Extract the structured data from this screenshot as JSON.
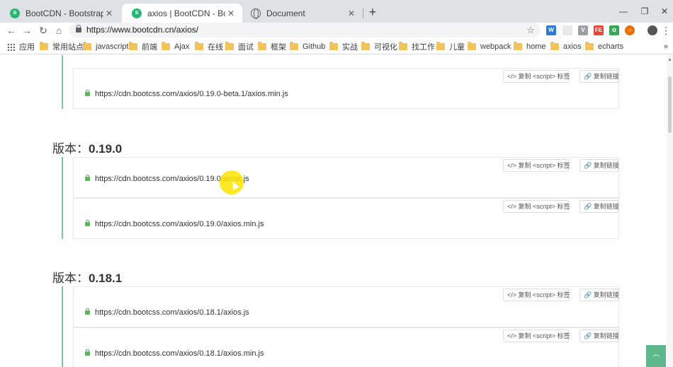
{
  "tabs": [
    {
      "title": "BootCDN - Bootstrap 中文网开",
      "icon": "bootcdn-icon"
    },
    {
      "title": "axios | BootCDN - Bootstrap 中",
      "icon": "bootcdn-icon"
    },
    {
      "title": "Document",
      "icon": "globe-icon"
    }
  ],
  "omnibox": {
    "url": "https://www.bootcdn.cn/axios/"
  },
  "bookmarks": {
    "apps": "应用",
    "items": [
      "常用站点",
      "javascript",
      "前端",
      "Ajax",
      "在线",
      "面试",
      "框架",
      "Github",
      "实战",
      "可视化",
      "找工作",
      "儿童",
      "webpack",
      "home",
      "axios",
      "echarts"
    ]
  },
  "buttons": {
    "script": "</> 复制 <script> 标签",
    "link": "🔗 复制链接"
  },
  "versions": [
    {
      "label": "版本：",
      "number": "0.19.0"
    },
    {
      "label": "版本：",
      "number": "0.18.1"
    }
  ],
  "rows": [
    "https://cdn.bootcss.com/axios/0.19.0-beta.1/axios.min.js",
    "https://cdn.bootcss.com/axios/0.19.0/axios.js",
    "https://cdn.bootcss.com/axios/0.19.0/axios.min.js",
    "https://cdn.bootcss.com/axios/0.18.1/axios.js",
    "https://cdn.bootcss.com/axios/0.18.1/axios.min.js"
  ],
  "accent": "#5cb88a"
}
